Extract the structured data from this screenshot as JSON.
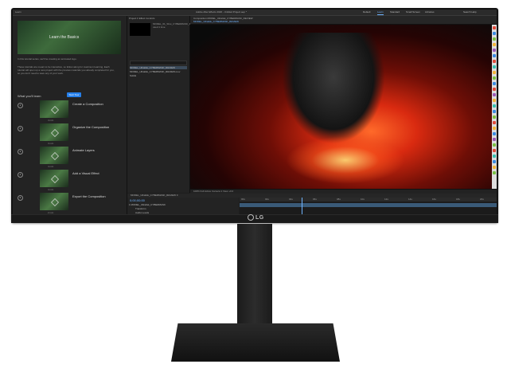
{
  "menubar": {
    "title": "Adobe After Effects 2020 - Untitled Project.aep *",
    "left_label": "Learn",
    "workspaces": [
      "Default",
      "Learn",
      "Standard",
      "Small Screen",
      "Libraries"
    ],
    "active_workspace": "Learn",
    "search_help": "Search Help"
  },
  "learn": {
    "header": "Learn",
    "hero_title": "Learn the Basics",
    "intro_1": "In this tutorial series, we'll be creating an animated logo.",
    "intro_2": "These tutorials are meant to be interactive, so follow along for maximum learning. Each tutorial will open up a new project with the preview materials you already completed for you, so you don't need to save any of your work.",
    "what_youll_learn": "What you'll learn",
    "start_button": "Start Tour",
    "steps": [
      {
        "num": "1",
        "label": "Create a Composition",
        "minutes": "4 min"
      },
      {
        "num": "2",
        "label": "Organize the Composition",
        "minutes": "3 min"
      },
      {
        "num": "3",
        "label": "Animate Layers",
        "minutes": "4 min"
      },
      {
        "num": "4",
        "label": "Add a Visual Effect",
        "minutes": "4 min"
      },
      {
        "num": "5",
        "label": "Export the Composition",
        "minutes": "2 min"
      }
    ]
  },
  "project": {
    "tabs": "Project  ≡    Effect Controls",
    "info": "MODEL_01_Shot_CYBERMASK_REVIEW.mov, used 1 time",
    "rows": [
      "MODEL_Ultralisk_CYBERMASK_REVIEW",
      "MODEL_Ultralisk_CYBERMASK_REVIEW.mov",
      "Solids"
    ]
  },
  "composition": {
    "tab": "Composition MODEL_Ultralisk_CYBERMASK_REVIEW",
    "name": "MODEL_Ultralisk_CYBERMASK_REVIEW",
    "toolbar": "100%   Full   Active Camera   1 View   +0.0"
  },
  "timeline": {
    "tab": "MODEL_Ultralisk_CYBERMASK_REVIEW  ≡",
    "timecode": "0;00;00;00",
    "layers": [
      "1  MODEL_Ultralisk_CYBERMASK",
      "Transform",
      "Audio Levels"
    ],
    "ruler": [
      "00s",
      "02s",
      "04s",
      "06s",
      "08s",
      "10s",
      "12s",
      "14s",
      "16s",
      "18s",
      "20s"
    ]
  },
  "brand": {
    "logo": "LG"
  },
  "colors": {
    "accent": "#2680eb",
    "timecode": "#6fb3ff"
  }
}
